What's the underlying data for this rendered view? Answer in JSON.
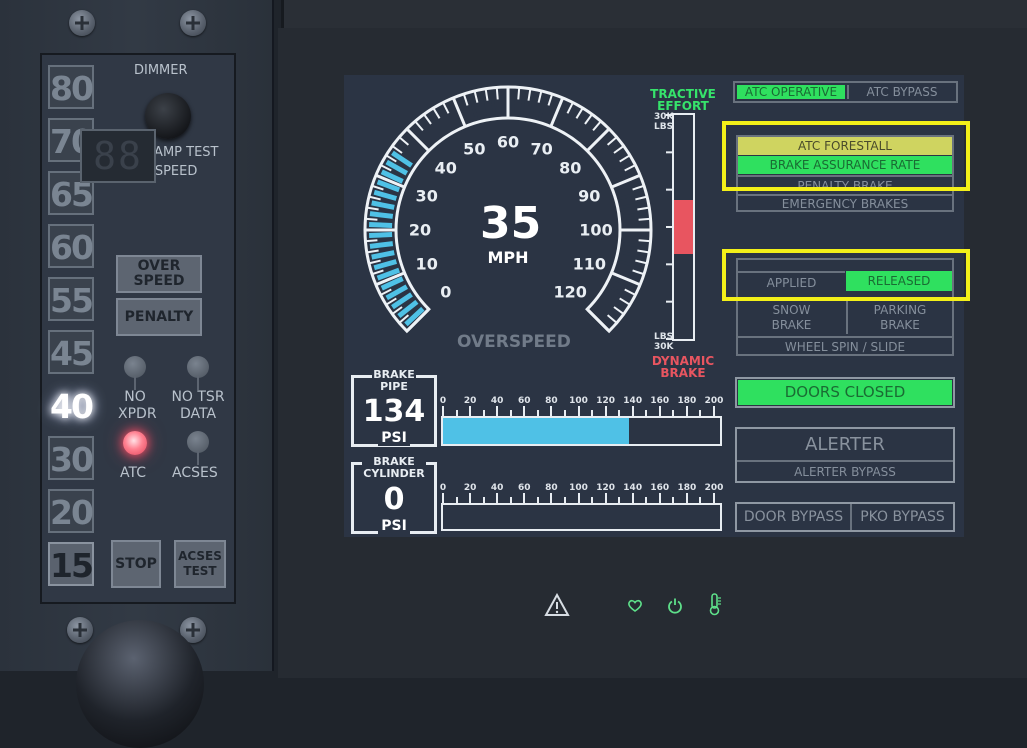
{
  "left_panel": {
    "speed_buttons": [
      "80",
      "70",
      "65",
      "60",
      "55",
      "45",
      "40",
      "30",
      "20",
      "15"
    ],
    "lit_speed": "40",
    "dimmer_label": "DIMMER",
    "lamp_test_label": "PUSH LAMP TEST",
    "track_speed_label": "TRACK  SPEED",
    "track_speed_display": "88",
    "overspeed_label_1": "OVER",
    "overspeed_label_2": "SPEED",
    "penalty_label": "PENALTY",
    "no_xpdr_1": "NO",
    "no_xpdr_2": "XPDR",
    "no_tsr_1": "NO TSR",
    "no_tsr_2": "DATA",
    "atc_label": "ATC",
    "acses_label": "ACSES",
    "stop_label": "STOP",
    "acses_test_1": "ACSES",
    "acses_test_2": "TEST"
  },
  "speedometer": {
    "scale": [
      "0",
      "10",
      "20",
      "30",
      "40",
      "50",
      "60",
      "70",
      "80",
      "90",
      "100",
      "110",
      "120"
    ],
    "speed": "35",
    "unit": "MPH",
    "speed_value": 35,
    "max_speed": 120,
    "overspeed_label": "OVERSPEED"
  },
  "tractive_effort": {
    "top_label_1": "TRACTIVE",
    "top_label_2": "EFFORT",
    "top_scale_1": "30K",
    "top_scale_2": "LBS",
    "bottom_scale_1": "LBS",
    "bottom_scale_2": "30K",
    "bottom_label_1": "DYNAMIC",
    "bottom_label_2": "BRAKE",
    "value_fraction": 0.12
  },
  "brake_pipe": {
    "title_1": "BRAKE",
    "title_2": "PIPE",
    "value": "134",
    "unit": "PSI",
    "bar_fraction": 0.67,
    "ticks": [
      "0",
      "20",
      "40",
      "60",
      "80",
      "100",
      "120",
      "140",
      "160",
      "180",
      "200"
    ]
  },
  "brake_cylinder": {
    "title_1": "BRAKE",
    "title_2": "CYLINDER",
    "value": "0",
    "unit": "PSI",
    "bar_fraction": 0,
    "ticks": [
      "0",
      "20",
      "40",
      "60",
      "80",
      "100",
      "120",
      "140",
      "160",
      "180",
      "200"
    ]
  },
  "status": {
    "atc_operative": "ATC OPERATIVE",
    "atc_bypass": "ATC BYPASS",
    "atc_forestall": "ATC FORESTALL",
    "brake_assurance_rate": "BRAKE ASSURANCE RATE",
    "penalty_brake": "PENALTY BRAKE",
    "emergency_brakes": "EMERGENCY BRAKES",
    "applied": "APPLIED",
    "released": "RELEASED",
    "snow_brake_1": "SNOW",
    "snow_brake_2": "BRAKE",
    "parking_brake_1": "PARKING",
    "parking_brake_2": "BRAKE",
    "wheel_spin": "WHEEL SPIN / SLIDE",
    "doors_closed": "DOORS CLOSED",
    "alerter": "ALERTER",
    "alerter_bypass": "ALERTER BYPASS",
    "door_bypass": "DOOR BYPASS",
    "pko_bypass": "PKO BYPASS"
  },
  "indicators": {
    "warning_icon": "warning-triangle-icon",
    "heart_icon": "heart-icon",
    "power_icon": "power-icon",
    "thermometer_icon": "thermometer-icon"
  },
  "colors": {
    "green": "#2fe05f",
    "yellow": "#cfd460",
    "highlight": "#f3f019",
    "bar_blue": "#4fc1e6",
    "te_red": "#e85560",
    "te_green": "#36e36b",
    "atc_lamp": "#ff6f83"
  }
}
